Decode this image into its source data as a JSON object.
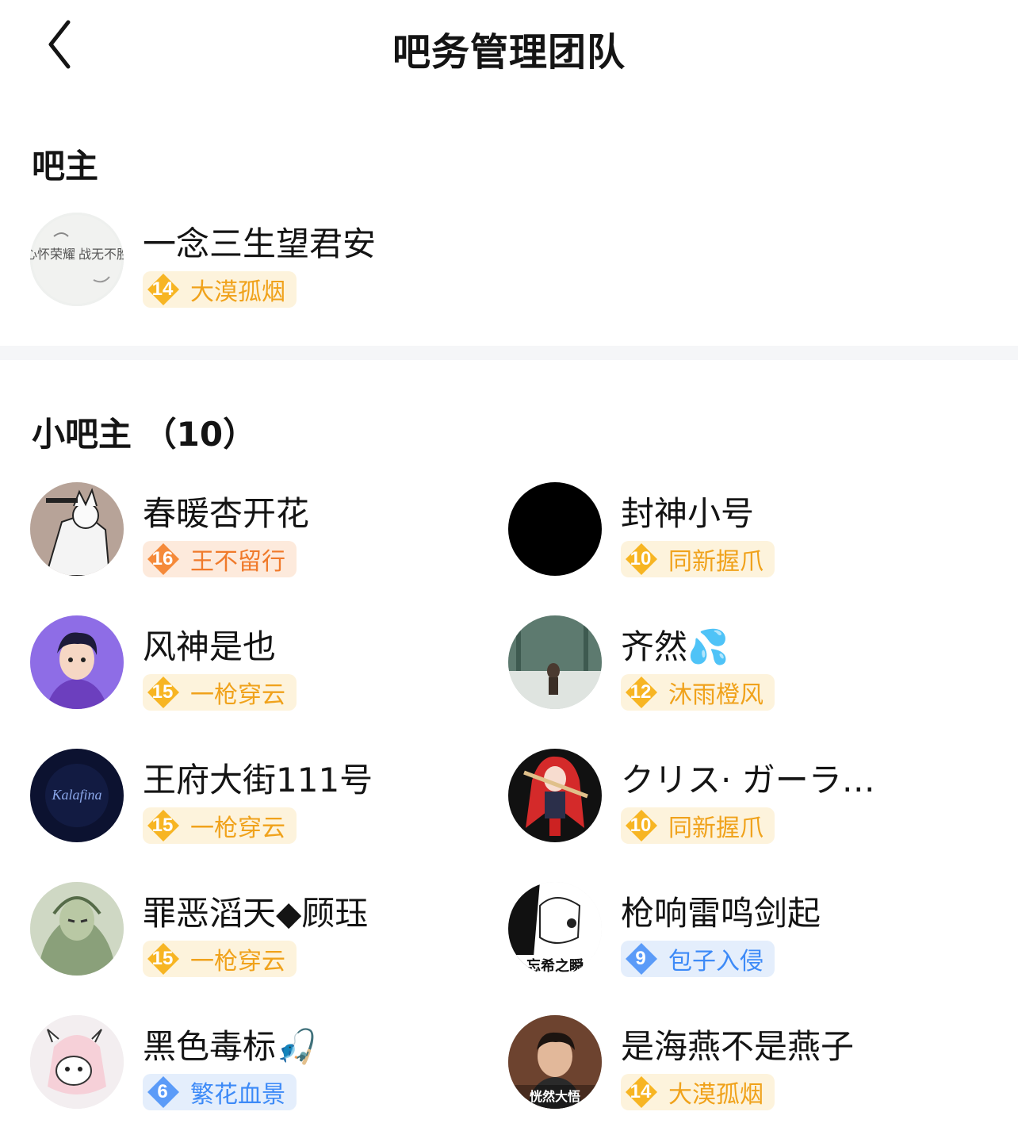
{
  "header": {
    "title": "吧务管理团队"
  },
  "owner_section": {
    "title": "吧主"
  },
  "owner": {
    "name": "一念三生望君安",
    "level": "14",
    "badge": "大漠孤烟",
    "avatar_text": "心怀荣耀 战无不胜"
  },
  "deputy_section": {
    "title": "小吧主 （10）"
  },
  "deputies": [
    {
      "name": "春暖杏开花",
      "level": "16",
      "badge": "王不留行"
    },
    {
      "name": "封神小号",
      "level": "10",
      "badge": "同新握爪"
    },
    {
      "name": "风神是也",
      "level": "15",
      "badge": "一枪穿云"
    },
    {
      "name": "齐然💦",
      "level": "12",
      "badge": "沐雨橙风"
    },
    {
      "name": "王府大街111号",
      "level": "15",
      "badge": "一枪穿云",
      "avatar_text": "Kalafina"
    },
    {
      "name": "クリス· ガーラ…",
      "level": "10",
      "badge": "同新握爪"
    },
    {
      "name": "罪恶滔天◆顾珏",
      "level": "15",
      "badge": "一枪穿云"
    },
    {
      "name": "枪响雷鸣剑起",
      "level": "9",
      "badge": "包子入侵",
      "avatar_text": "忘希之瞬"
    },
    {
      "name": "黑色毒标🎣",
      "level": "6",
      "badge": "繁花血景"
    },
    {
      "name": "是海燕不是燕子",
      "level": "14",
      "badge": "大漠孤烟",
      "avatar_text": "恍然大悟"
    }
  ],
  "colors": {
    "badge_gold": "#f0a21b",
    "badge_orange": "#f07a2b",
    "badge_blue": "#3d8af7",
    "divider": "#f5f6f8"
  }
}
